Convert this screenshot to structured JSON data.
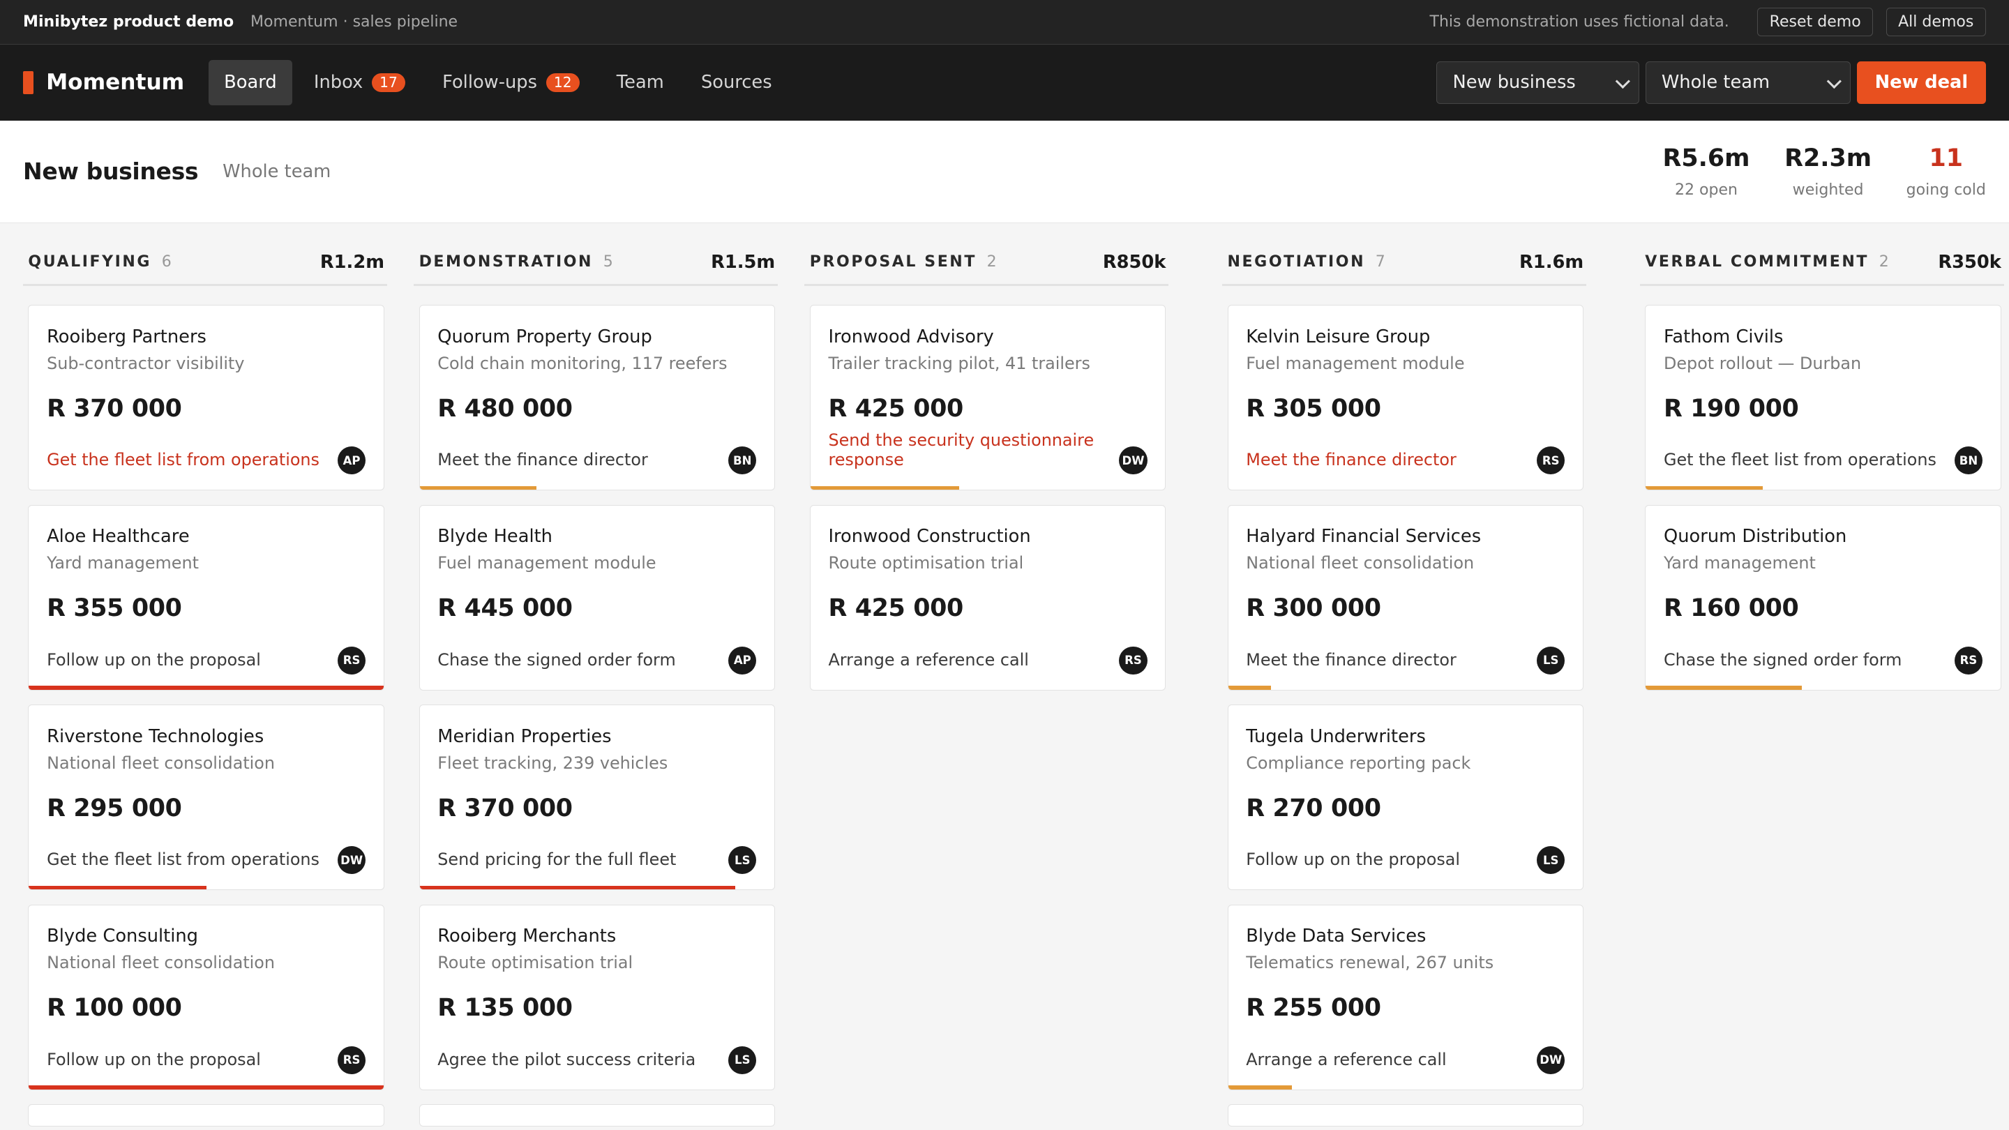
{
  "demo_bar": {
    "product": "Minibytez product demo",
    "subtitle": "Momentum · sales pipeline",
    "note": "This demonstration uses fictional data.",
    "reset_label": "Reset demo",
    "all_demos_label": "All demos"
  },
  "nav": {
    "logo": "Momentum",
    "board": "Board",
    "inbox": "Inbox",
    "inbox_count": "17",
    "followups": "Follow-ups",
    "followups_count": "12",
    "team": "Team",
    "sources": "Sources",
    "pipeline_select": "New business",
    "team_select": "Whole team",
    "new_deal": "New deal"
  },
  "header": {
    "title": "New business",
    "scope": "Whole team",
    "stats": [
      {
        "value": "R5.6m",
        "label": "22 open"
      },
      {
        "value": "R2.3m",
        "label": "weighted"
      },
      {
        "value": "11",
        "label": "going cold"
      }
    ]
  },
  "colors": {
    "accent": "#e8501f",
    "overdue": "#c8321d",
    "bar_red": "#d8331d",
    "bar_amber": "#e39a38"
  },
  "columns": [
    {
      "name": "QUALIFYING",
      "count": "6",
      "total": "R1.2m",
      "cards": [
        {
          "company": "Rooiberg Partners",
          "desc": "Sub-contractor visibility",
          "amount": "R 370 000",
          "action": "Get the fleet list from operations",
          "owner": "AP",
          "overdue": true,
          "bar": "none"
        },
        {
          "company": "Aloe Healthcare",
          "desc": "Yard management",
          "amount": "R 355 000",
          "action": "Follow up on the proposal",
          "owner": "RS",
          "overdue": false,
          "bar": "red",
          "bar_fill": 1.0
        },
        {
          "company": "Riverstone Technologies",
          "desc": "National fleet consolidation",
          "amount": "R 295 000",
          "action": "Get the fleet list from operations",
          "owner": "DW",
          "overdue": false,
          "bar": "red",
          "bar_fill": 0.5
        },
        {
          "company": "Blyde Consulting",
          "desc": "National fleet consolidation",
          "amount": "R 100 000",
          "action": "Follow up on the proposal",
          "owner": "RS",
          "overdue": false,
          "bar": "red",
          "bar_fill": 1.0
        }
      ]
    },
    {
      "name": "DEMONSTRATION",
      "count": "5",
      "total": "R1.5m",
      "cards": [
        {
          "company": "Quorum Property Group",
          "desc": "Cold chain monitoring, 117 reefers",
          "amount": "R 480 000",
          "action": "Meet the finance director",
          "owner": "BN",
          "overdue": false,
          "bar": "amber",
          "bar_fill": 0.33
        },
        {
          "company": "Blyde Health",
          "desc": "Fuel management module",
          "amount": "R 445 000",
          "action": "Chase the signed order form",
          "owner": "AP",
          "overdue": false,
          "bar": "none"
        },
        {
          "company": "Meridian Properties",
          "desc": "Fleet tracking, 239 vehicles",
          "amount": "R 370 000",
          "action": "Send pricing for the full fleet",
          "owner": "LS",
          "overdue": false,
          "bar": "red",
          "bar_fill": 0.89
        },
        {
          "company": "Rooiberg Merchants",
          "desc": "Route optimisation trial",
          "amount": "R 135 000",
          "action": "Agree the pilot success criteria",
          "owner": "LS",
          "overdue": false,
          "bar": "none"
        }
      ]
    },
    {
      "name": "PROPOSAL SENT",
      "count": "2",
      "total": "R850k",
      "cards": [
        {
          "company": "Ironwood Advisory",
          "desc": "Trailer tracking pilot, 41 trailers",
          "amount": "R 425 000",
          "action": "Send the security questionnaire response",
          "owner": "DW",
          "overdue": true,
          "bar": "amber",
          "bar_fill": 0.42
        },
        {
          "company": "Ironwood Construction",
          "desc": "Route optimisation trial",
          "amount": "R 425 000",
          "action": "Arrange a reference call",
          "owner": "RS",
          "overdue": false,
          "bar": "none"
        }
      ]
    },
    {
      "name": "NEGOTIATION",
      "count": "7",
      "total": "R1.6m",
      "cards": [
        {
          "company": "Kelvin Leisure Group",
          "desc": "Fuel management module",
          "amount": "R 305 000",
          "action": "Meet the finance director",
          "owner": "RS",
          "overdue": true,
          "bar": "none"
        },
        {
          "company": "Halyard Financial Services",
          "desc": "National fleet consolidation",
          "amount": "R 300 000",
          "action": "Meet the finance director",
          "owner": "LS",
          "overdue": false,
          "bar": "amber",
          "bar_fill": 0.12
        },
        {
          "company": "Tugela Underwriters",
          "desc": "Compliance reporting pack",
          "amount": "R 270 000",
          "action": "Follow up on the proposal",
          "owner": "LS",
          "overdue": false,
          "bar": "none"
        },
        {
          "company": "Blyde Data Services",
          "desc": "Telematics renewal, 267 units",
          "amount": "R 255 000",
          "action": "Arrange a reference call",
          "owner": "DW",
          "overdue": false,
          "bar": "amber",
          "bar_fill": 0.18
        }
      ]
    },
    {
      "name": "VERBAL COMMITMENT",
      "count": "2",
      "total": "R350k",
      "cards": [
        {
          "company": "Fathom Civils",
          "desc": "Depot rollout — Durban",
          "amount": "R 190 000",
          "action": "Get the fleet list from operations",
          "owner": "BN",
          "overdue": false,
          "bar": "amber",
          "bar_fill": 0.33
        },
        {
          "company": "Quorum Distribution",
          "desc": "Yard management",
          "amount": "R 160 000",
          "action": "Chase the signed order form",
          "owner": "RS",
          "overdue": false,
          "bar": "amber",
          "bar_fill": 0.44
        }
      ]
    }
  ]
}
